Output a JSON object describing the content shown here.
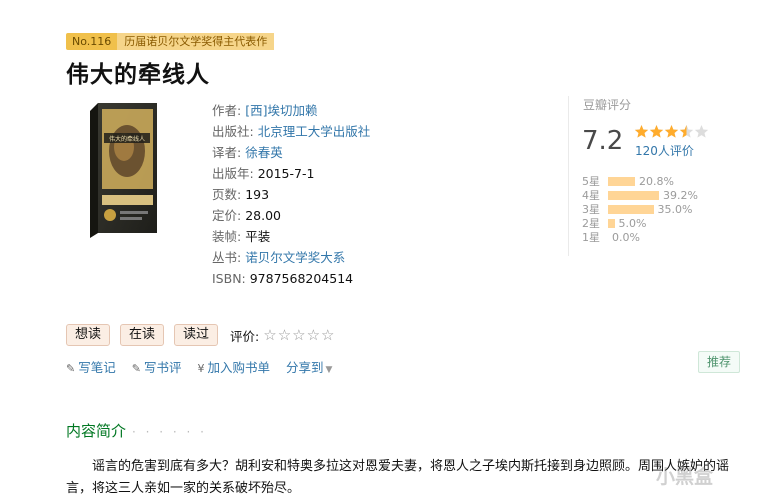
{
  "ribbon": {
    "no": "No.116",
    "text": "历届诺贝尔文学奖得主代表作"
  },
  "book": {
    "title": "伟大的牵线人",
    "cover_title": "伟大的牵线人",
    "info": [
      {
        "label": "作者: ",
        "value": "[西]埃切加赖",
        "link": true
      },
      {
        "label": "出版社: ",
        "value": "北京理工大学出版社",
        "link": true
      },
      {
        "label": "译者: ",
        "value": "徐春英",
        "link": true
      },
      {
        "label": "出版年: ",
        "value": "2015-7-1",
        "link": false
      },
      {
        "label": "页数: ",
        "value": "193",
        "link": false
      },
      {
        "label": "定价: ",
        "value": "28.00",
        "link": false
      },
      {
        "label": "装帧: ",
        "value": "平装",
        "link": false
      },
      {
        "label": "丛书: ",
        "value": "诺贝尔文学奖大系",
        "link": true
      },
      {
        "label": "ISBN: ",
        "value": "9787568204514",
        "link": false
      }
    ]
  },
  "rating": {
    "header": "豆瓣评分",
    "score": "7.2",
    "stars_value": 3.5,
    "people": "120人评价",
    "bars": [
      {
        "label": "5星",
        "pct": "20.8%",
        "value": 20.8
      },
      {
        "label": "4星",
        "pct": "39.2%",
        "value": 39.2
      },
      {
        "label": "3星",
        "pct": "35.0%",
        "value": 35.0
      },
      {
        "label": "2星",
        "pct": "5.0%",
        "value": 5.0
      },
      {
        "label": "1星",
        "pct": "0.0%",
        "value": 0.0
      }
    ]
  },
  "actions": {
    "want": "想读",
    "reading": "在读",
    "read": "读过",
    "rate_label": "评价:",
    "empty_stars": "☆☆☆☆☆"
  },
  "links": {
    "write_note": "写笔记",
    "write_review": "写书评",
    "add_cart": "加入购书单",
    "share": "分享到",
    "recommend": "推荐"
  },
  "section": {
    "title": "内容简介",
    "dots": "· · · · · ·"
  },
  "intro": "谣言的危害到底有多大？胡利安和特奥多拉这对恩爱夫妻，将恩人之子埃内斯托接到身边照顾。周围人嫉妒的谣言，将这三人亲如一家的关系破坏殆尽。",
  "watermark": "小黑盒"
}
